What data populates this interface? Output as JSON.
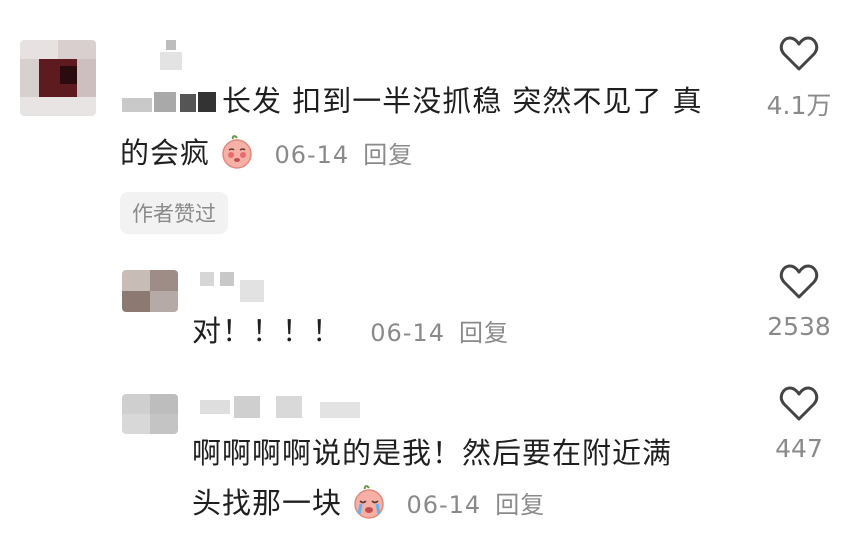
{
  "comments": [
    {
      "text_line1": "长发 扣到一半没抓稳 突然不见了 真",
      "text_line2": "的会疯",
      "date": "06-14",
      "reply_label": "回复",
      "likes": "4.1万",
      "author_liked_badge": "作者赞过"
    },
    {
      "text_line1": "对！！！！",
      "date": "06-14",
      "reply_label": "回复",
      "likes": "2538"
    },
    {
      "text_line1": "啊啊啊啊说的是我！然后要在附近满",
      "text_line2": "头找那一块",
      "date": "06-14",
      "reply_label": "回复",
      "likes": "447"
    }
  ],
  "icons": {
    "like": "heart-outline-icon",
    "emoji_shy": "shy-face-emoji",
    "emoji_cry": "crying-face-emoji"
  },
  "colors": {
    "text": "#1f1f1f",
    "meta": "#8a8a8a",
    "badge_bg": "#f2f2f2",
    "emoji_skin": "#f6a7a0"
  }
}
